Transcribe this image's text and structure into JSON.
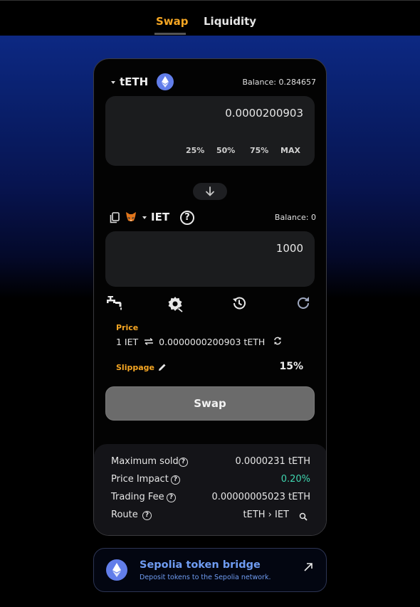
{
  "tabs": {
    "swap": "Swap",
    "liquidity": "Liquidity"
  },
  "from": {
    "token": "tETH",
    "balance": "Balance: 0.284657",
    "amount": "0.0000200903",
    "percent_buttons": [
      "25%",
      "50%",
      "75%",
      "MAX"
    ]
  },
  "to": {
    "token": "IET",
    "balance": "Balance: 0",
    "amount": "1000",
    "help": "?"
  },
  "price": {
    "label": "Price",
    "text": "1 IET",
    "value": "0.0000000200903 tETH"
  },
  "slippage": {
    "label": "Slippage",
    "value": "15%"
  },
  "swap_button": "Swap",
  "details": [
    {
      "label": "Maximum sold",
      "value": "0.0000231 tETH"
    },
    {
      "label": "Price Impact",
      "value": "0.20%"
    },
    {
      "label": "Trading Fee",
      "value": "0.00000005023 tETH"
    },
    {
      "label": "Route",
      "value": "tETH › IET"
    }
  ],
  "bridge": {
    "title": "Sepolia token bridge",
    "subtitle": "Deposit tokens to the Sepolia network."
  },
  "colors": {
    "accent": "#f5a623",
    "impact": "#3fd6b0",
    "bridge_text": "#6f9cf2",
    "eth": "#627eea"
  },
  "icons": [
    "ethereum-icon",
    "copy-icon",
    "metamask-fox-icon",
    "help-icon",
    "down-arrow-icon",
    "faucet-icon",
    "settings-icon",
    "history-icon",
    "refresh-icon",
    "swap-direction-icon",
    "edit-icon",
    "search-icon",
    "external-link-icon"
  ]
}
